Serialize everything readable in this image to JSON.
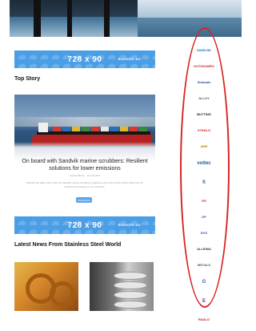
{
  "ads": [
    {
      "size_label": "728 x 90",
      "tag": "BANNER AD"
    },
    {
      "size_label": "728 x 90",
      "tag": "BANNER AD"
    }
  ],
  "sections": {
    "top_story": "Top Story",
    "latest_news": "Latest News From Stainless Steel World"
  },
  "feature": {
    "headline": "On board with Sandvik marine scrubbers: Resilient solutions for lower emissions",
    "meta": "Joanna Bunce · Jan 11 2021",
    "snippet": "Sandvik has taken part in the new Sandvik marine scrubbers programme for some of the world's ships and our solutions are helping to cut emissions.",
    "button": "Read More"
  },
  "sponsors": [
    {
      "name": "SANDVIK",
      "color": "#1d6fc4"
    },
    {
      "name": "OUTOKUMPU",
      "color": "#c42a2a"
    },
    {
      "name": "Schmolz",
      "color": "#1f3f8a"
    },
    {
      "name": "ALLOY",
      "color": "#555555"
    },
    {
      "name": "BUTTING",
      "color": "#222222"
    },
    {
      "name": "STAHLO",
      "color": "#d12424"
    },
    {
      "name": "AWE",
      "color": "#b58a00"
    },
    {
      "name": "voltec",
      "color": "#1f5aa0"
    },
    {
      "name": "fi",
      "color": "#1f5aa0"
    },
    {
      "name": "RS",
      "color": "#d22b2b"
    },
    {
      "name": "GP",
      "color": "#2a5db0"
    },
    {
      "name": "EVS",
      "color": "#2a4f8f"
    },
    {
      "name": "ALLEIMA",
      "color": "#3a3a3a"
    },
    {
      "name": "METALS",
      "color": "#555555"
    },
    {
      "name": "G",
      "color": "#2a65b0"
    },
    {
      "name": "E",
      "color": "#6a2a8a"
    },
    {
      "name": "RAALO",
      "color": "#c42020"
    }
  ],
  "colors": {
    "ad_blue": "#4a9ee6",
    "highlight_red": "#d82424"
  }
}
